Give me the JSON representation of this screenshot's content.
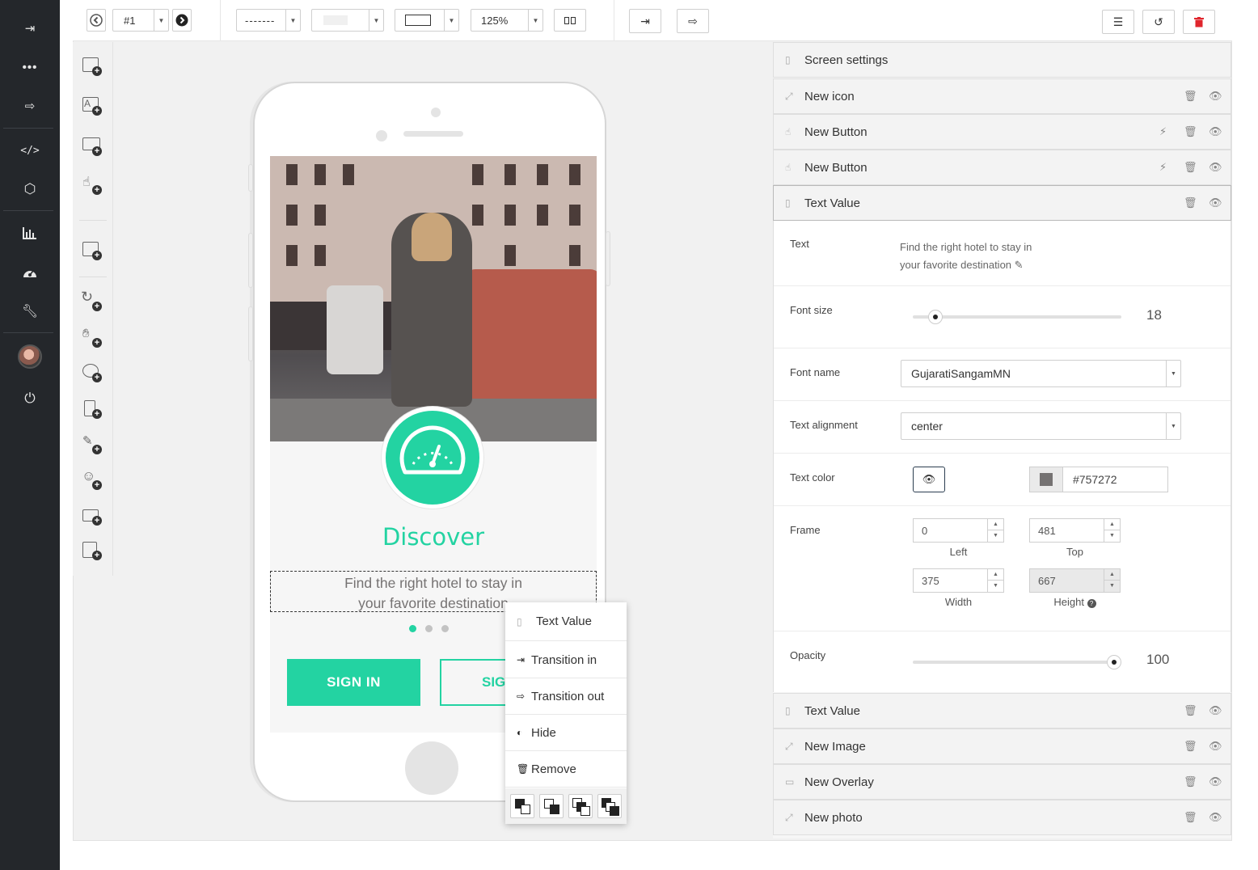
{
  "nav": {
    "icons": [
      "sign-in-icon",
      "more-icon",
      "sign-out-icon",
      "code-icon",
      "codepen-icon",
      "chart-icon",
      "dashboard-icon",
      "wrench-icon",
      "avatar",
      "power-icon"
    ]
  },
  "toolbar": {
    "screen_label": "#1",
    "line_style": "-------",
    "zoom": "125%"
  },
  "phone": {
    "title": "Discover",
    "subtitle_line1": "Find the right hotel to stay in",
    "subtitle_line2": "your favorite destination",
    "signin_label": "SIGN IN",
    "signup_label": "SIGN"
  },
  "context_menu": {
    "header": "Text Value",
    "items": [
      "Transition in",
      "Transition out",
      "Hide",
      "Remove"
    ]
  },
  "panel": {
    "screen_settings": "Screen settings",
    "layers_top": [
      "New icon",
      "New Button",
      "New Button",
      "Text Value"
    ],
    "layers_bottom": [
      "Text Value",
      "New Image",
      "New Overlay",
      "New photo"
    ],
    "text_label": "Text",
    "text_value_line1": "Find the right hotel to stay in",
    "text_value_line2": "your favorite destination",
    "font_size_label": "Font size",
    "font_size_value": "18",
    "font_size_fraction": 0.08,
    "font_name_label": "Font name",
    "font_name_value": "GujaratiSangamMN",
    "text_alignment_label": "Text alignment",
    "text_alignment_value": "center",
    "text_color_label": "Text color",
    "text_color_value": "#757272",
    "frame_label": "Frame",
    "frame": {
      "left": "0",
      "left_label": "Left",
      "top": "481",
      "top_label": "Top",
      "width": "375",
      "width_label": "Width",
      "height": "667",
      "height_label": "Height"
    },
    "opacity_label": "Opacity",
    "opacity_value": "100",
    "opacity_fraction": 1.0
  },
  "colors": {
    "accent": "#23d3a2",
    "nav_bg": "#24272b",
    "delete_red": "#e0262d"
  }
}
